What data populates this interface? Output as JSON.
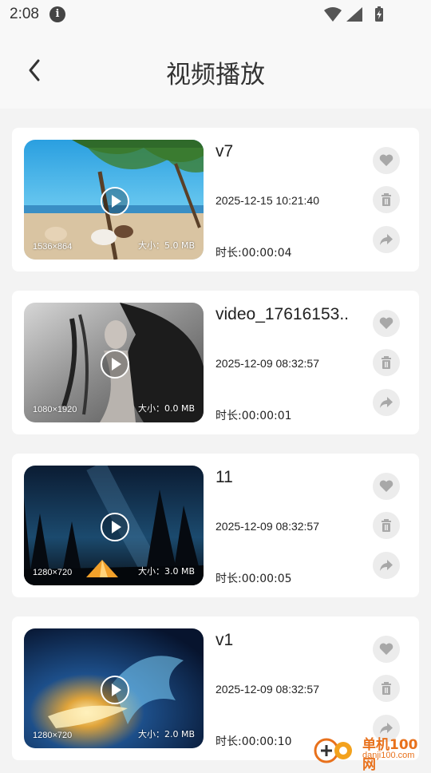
{
  "status_bar": {
    "time": "2:08",
    "info_icon": "i"
  },
  "header": {
    "title": "视频播放",
    "back_icon": "chevron-left-icon"
  },
  "videos": [
    {
      "name": "v7",
      "date": "2025-12-15 10:21:40",
      "duration": "时长:00:00:04",
      "resolution": "1536×864",
      "size": "大小：5.0 MB"
    },
    {
      "name": "video_17616153..",
      "date": "2025-12-09 08:32:57",
      "duration": "时长:00:00:01",
      "resolution": "1080×1920",
      "size": "大小：0.0 MB"
    },
    {
      "name": "11",
      "date": "2025-12-09 08:32:57",
      "duration": "时长:00:00:05",
      "resolution": "1280×720",
      "size": "大小：3.0 MB"
    },
    {
      "name": "v1",
      "date": "2025-12-09 08:32:57",
      "duration": "时长:00:00:10",
      "resolution": "1280×720",
      "size": "大小：2.0 MB"
    }
  ],
  "watermark": {
    "line1": "单机100网",
    "line2": "danji100.com"
  },
  "colors": {
    "background": "#f3f3f3",
    "card": "#ffffff",
    "action_circle": "#ececec",
    "action_icon": "#a8a8a8",
    "watermark": "#e8711c"
  }
}
